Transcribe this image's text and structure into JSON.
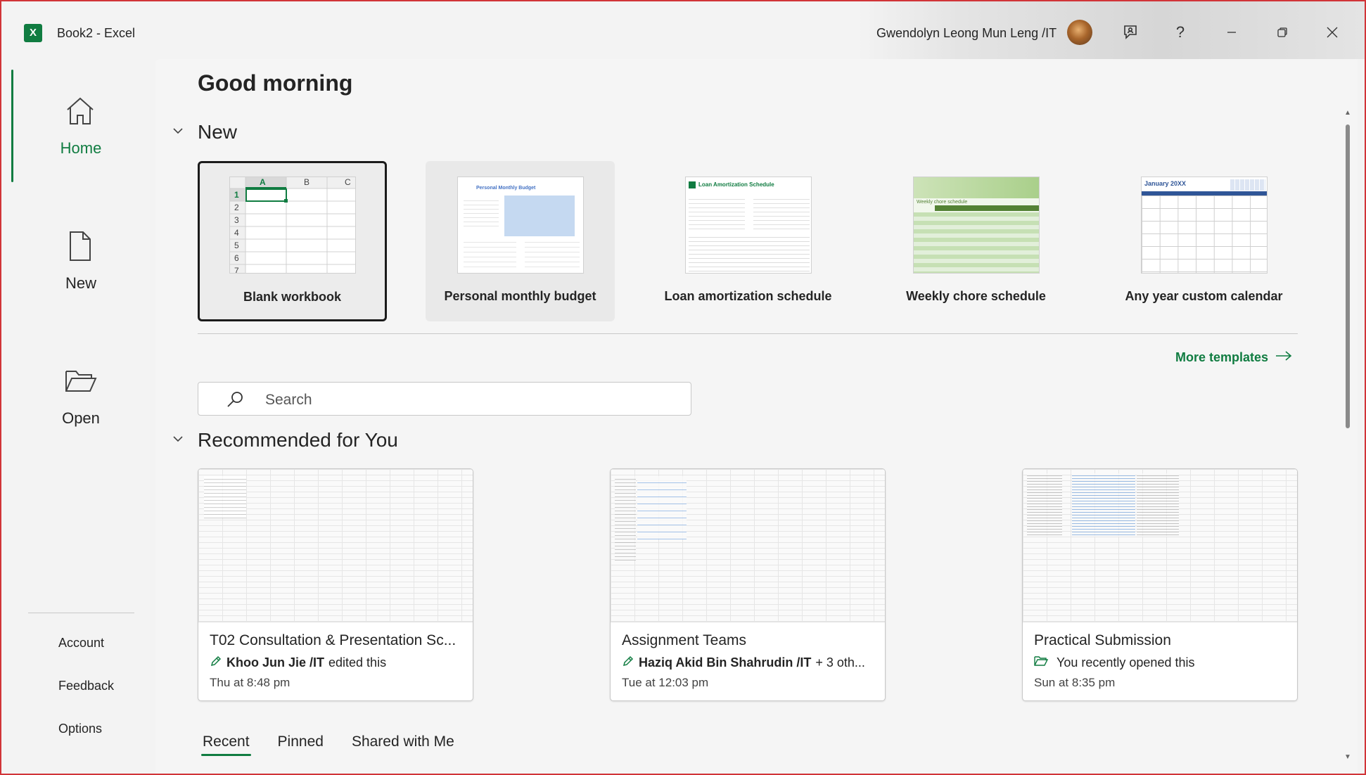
{
  "window": {
    "app_icon": "excel-icon",
    "title": "Book2  -  Excel",
    "user_name": "Gwendolyn Leong Mun Leng /IT",
    "controls": [
      "feedback-icon",
      "help-icon",
      "minimize-icon",
      "restore-icon",
      "close-icon"
    ],
    "help_glyph": "?"
  },
  "sidebar": {
    "items": [
      {
        "label": "Home",
        "icon": "home-icon",
        "active": true
      },
      {
        "label": "New",
        "icon": "new-file-icon",
        "active": false
      },
      {
        "label": "Open",
        "icon": "folder-open-icon",
        "active": false
      }
    ],
    "bottom_links": [
      "Account",
      "Feedback",
      "Options"
    ]
  },
  "main": {
    "greeting": "Good morning",
    "new_section": {
      "heading": "New",
      "templates": [
        {
          "label": "Blank workbook",
          "selected": true
        },
        {
          "label": "Personal monthly budget",
          "thumb_title": "Personal Monthly Budget"
        },
        {
          "label": "Loan amortization schedule",
          "thumb_title": "Loan Amortization Schedule"
        },
        {
          "label": "Weekly chore schedule",
          "thumb_title": "Weekly chore schedule"
        },
        {
          "label": "Any year custom calendar",
          "thumb_title": "January 20XX"
        }
      ],
      "blank_cols": [
        "A",
        "B",
        "C"
      ],
      "blank_rows": [
        "1",
        "2",
        "3",
        "4",
        "5",
        "6",
        "7"
      ],
      "more_templates": "More templates"
    },
    "search": {
      "placeholder": "Search"
    },
    "recommended": {
      "heading": "Recommended for You",
      "cards": [
        {
          "title": "T02 Consultation & Presentation Sc...",
          "actor": "Khoo Jun Jie /IT",
          "activity": " edited this",
          "time": "Thu at 8:48 pm",
          "activity_icon": "pencil-icon"
        },
        {
          "title": "Assignment Teams",
          "actor": "Haziq Akid Bin Shahrudin /IT",
          "activity": " + 3 oth...",
          "time": "Tue at 12:03 pm",
          "activity_icon": "pencil-icon"
        },
        {
          "title": "Practical Submission",
          "actor": "",
          "activity": "You recently opened this",
          "time": "Sun at 8:35 pm",
          "activity_icon": "folder-open-icon"
        }
      ]
    },
    "tabs": [
      "Recent",
      "Pinned",
      "Shared with Me"
    ],
    "active_tab": "Recent"
  },
  "colors": {
    "accent": "#107c41",
    "frame": "#d13438"
  }
}
